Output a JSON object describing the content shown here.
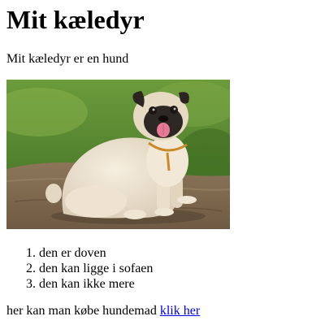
{
  "page": {
    "heading": "Mit kæledyr",
    "intro": "Mit kæledyr er en hund"
  },
  "image": {
    "subject": "pug-dog-photo"
  },
  "list": {
    "items": [
      "den er doven",
      "den kan ligge i sofaen",
      "den kan ikke mere"
    ]
  },
  "footer": {
    "text": "her kan man købe hundemad ",
    "link_label": "klik her",
    "link_color": "#0000ee"
  }
}
